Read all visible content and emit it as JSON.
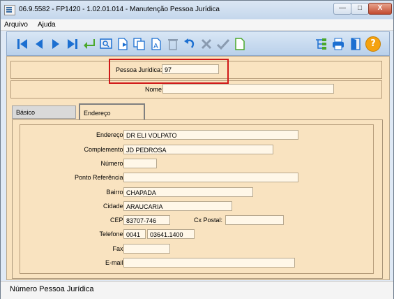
{
  "window": {
    "title": "06.9.5582 - FP1420 - 1.02.01.014 - Manutenção Pessoa Jurídica",
    "minimize_glyph": "—",
    "maximize_glyph": "□",
    "close_glyph": "X"
  },
  "menu": {
    "items": [
      "Arquivo",
      "Ajuda"
    ]
  },
  "toolbar": {
    "buttons": [
      "first-record-icon",
      "previous-record-icon",
      "next-record-icon",
      "last-record-icon",
      "confirm-return-icon",
      "search-icon",
      "new-record-icon",
      "copy-icon",
      "edit-icon",
      "delete-icon",
      "undo-icon",
      "cancel-icon",
      "save-check-icon",
      "blank-document-icon",
      "tree-icon",
      "print-icon",
      "exit-door-icon",
      "help-icon"
    ],
    "help_glyph": "?"
  },
  "header": {
    "pessoa_juridica_label": "Pessoa Jurídica:",
    "pessoa_juridica_value": "97",
    "nome_label": "Nome:",
    "nome_value": ""
  },
  "tabs": [
    "Básico",
    "Endereço"
  ],
  "address": {
    "endereco_label": "Endereço:",
    "endereco_value": "DR ELI VOLPATO",
    "complemento_label": "Complemento:",
    "complemento_value": "JD PEDROSA",
    "numero_label": "Número:",
    "numero_value": "",
    "ponto_referencia_label": "Ponto Referência:",
    "ponto_referencia_value": "",
    "bairro_label": "Bairro:",
    "bairro_value": "CHAPADA",
    "cidade_label": "Cidade:",
    "cidade_value": "ARAUCARIA",
    "cep_label": "CEP:",
    "cep_value": "83707-746",
    "cx_postal_label": "Cx Postal:",
    "cx_postal_value": "",
    "telefone_label": "Telefone:",
    "telefone_ddd": "0041",
    "telefone_number": "03641.1400",
    "fax_label": "Fax:",
    "fax_value": "",
    "email_label": "E-mail:",
    "email_value": ""
  },
  "status": {
    "text": "Número Pessoa Jurídica"
  },
  "colors": {
    "content_bg": "#f9e3c0",
    "highlight_border": "#d01818",
    "toolbar_icon": "#1c6fd1"
  }
}
